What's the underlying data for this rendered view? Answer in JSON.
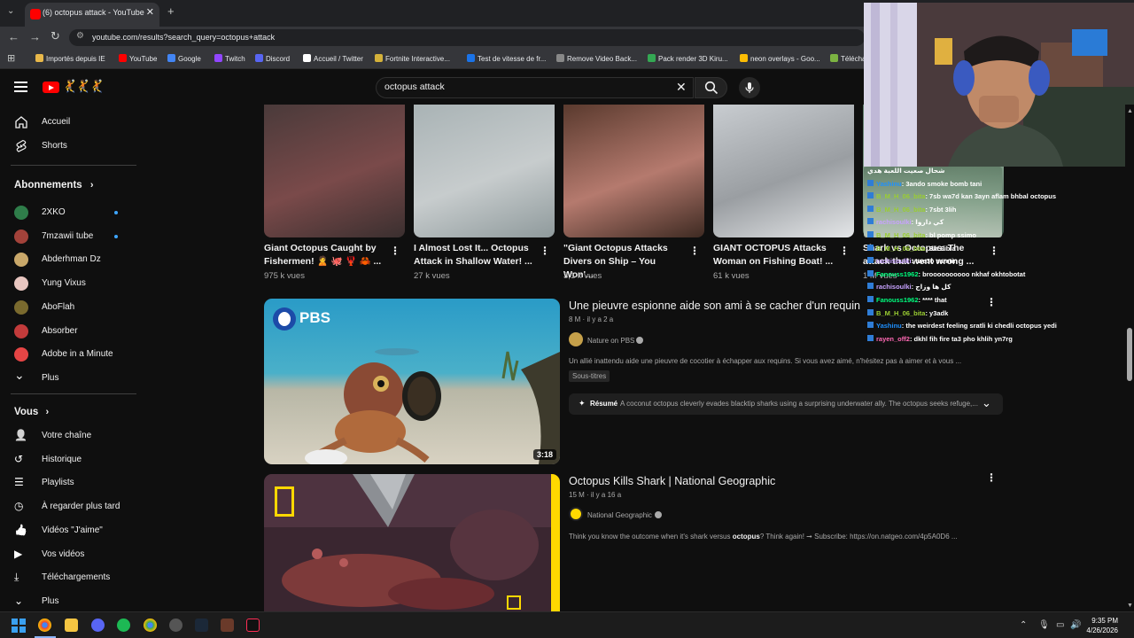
{
  "browser": {
    "tab_title": "(6) octopus attack - YouTube",
    "url": "youtube.com/results?search_query=octopus+attack",
    "bookmarks": [
      {
        "label": "Importés depuis IE",
        "color": "#e8b84a"
      },
      {
        "label": "YouTube",
        "color": "#ff0000"
      },
      {
        "label": "Google",
        "color": "#4285f4"
      },
      {
        "label": "Twitch",
        "color": "#9146ff"
      },
      {
        "label": "Discord",
        "color": "#5865f2"
      },
      {
        "label": "Accueil / Twitter",
        "color": "#ffffff"
      },
      {
        "label": "Fortnite Interactive...",
        "color": "#d4b13a"
      },
      {
        "label": "Test de vitesse de fr...",
        "color": "#1a73e8"
      },
      {
        "label": "Remove Video Back...",
        "color": "#888888"
      },
      {
        "label": "Pack render 3D Kiru...",
        "color": "#34a853"
      },
      {
        "label": "neon overlays - Goo...",
        "color": "#fbbc04"
      },
      {
        "label": "Téléchar...",
        "color": "#7cb342"
      }
    ]
  },
  "header": {
    "search_value": "octopus attack"
  },
  "sidebar": {
    "main": [
      {
        "label": "Accueil",
        "icon": "home-icon"
      },
      {
        "label": "Shorts",
        "icon": "shorts-icon"
      }
    ],
    "subscriptions_title": "Abonnements",
    "subscriptions": [
      {
        "label": "2XKO",
        "color": "#2f7d4a",
        "dot": true
      },
      {
        "label": "7mzawii tube",
        "color": "#a3423a",
        "dot": true
      },
      {
        "label": "Abderhman Dz",
        "color": "#c9a86a",
        "dot": false
      },
      {
        "label": "Yung Vixus",
        "color": "#e8c6c0",
        "dot": false
      },
      {
        "label": "AboFlah",
        "color": "#7a6a2e",
        "dot": false
      },
      {
        "label": "Absorber",
        "color": "#c23b3b",
        "dot": false
      },
      {
        "label": "Adobe in a Minute",
        "color": "#e64545",
        "dot": false
      },
      {
        "label": "Plus",
        "color": "",
        "dot": false
      }
    ],
    "you_title": "Vous",
    "you": [
      {
        "label": "Votre chaîne",
        "icon": "channel-icon"
      },
      {
        "label": "Historique",
        "icon": "history-icon"
      },
      {
        "label": "Playlists",
        "icon": "playlists-icon"
      },
      {
        "label": "À regarder plus tard",
        "icon": "watch-later-icon"
      },
      {
        "label": "Vidéos \"J'aime\"",
        "icon": "like-icon"
      },
      {
        "label": "Vos vidéos",
        "icon": "your-videos-icon"
      },
      {
        "label": "Téléchargements",
        "icon": "downloads-icon"
      },
      {
        "label": "Plus",
        "icon": "chevron-down-icon"
      }
    ]
  },
  "shorts": [
    {
      "title": "Giant Octopus Caught by Fishermen! 🙎 🐙 🦞 🦀 ...",
      "views": "975 k vues",
      "colors": [
        "#4a3a3a",
        "#7a4a4a",
        "#3a2f2f"
      ]
    },
    {
      "title": "I Almost Lost It... Octopus Attack in Shallow Water! ...",
      "views": "27 k vues",
      "colors": [
        "#a9b3b5",
        "#c7cccd",
        "#8f9a9c"
      ]
    },
    {
      "title": "\"Giant Octopus Attacks Divers on Ship – You Won'...",
      "views": "3,1 k vues",
      "colors": [
        "#5a3a2e",
        "#b57a6e",
        "#3e2a22"
      ]
    },
    {
      "title": "GIANT OCTOPUS Attacks Woman on Fishing Boat! ...",
      "views": "61 k vues",
      "colors": [
        "#c8ccd0",
        "#9a9ea2",
        "#e4e6e8"
      ]
    },
    {
      "title": "Shark vs Octopus: The attack that went wrong ...",
      "views": "1 M vues",
      "colors": [
        "#5a7868",
        "#8aa590",
        "#3e5a4c"
      ]
    }
  ],
  "videos": [
    {
      "title": "Une pieuvre espionne aide son ami à se cacher d'un requin",
      "meta": "8 M · il y a 2 a",
      "channel": "Nature on PBS",
      "desc": "Un allié inattendu aide une pieuvre de cocotier à échapper aux requins. Si vous avez aimé, n'hésitez pas à aimer et à vous ...",
      "badge": "Sous-titres",
      "summary_label": "Résumé",
      "summary": "A coconut octopus cleverly evades blacktip sharks using a surprising underwater ally. The octopus seeks refuge,...",
      "duration": "3:18",
      "brand": "PBS"
    },
    {
      "title": "Octopus Kills Shark | National Geographic",
      "meta": "15 M · il y a 16 a",
      "channel": "National Geographic",
      "desc_pre": "Think you know the outcome when it's shark versus ",
      "desc_bold": "octopus",
      "desc_post": "? Think again! ➞ Subscribe: https://on.natgeo.com/4p5A0D6 ..."
    }
  ],
  "chat": [
    {
      "user": "",
      "msg": "شحال صعيت اللعبة هدي",
      "color": "#ffffff"
    },
    {
      "user": "Yashinu",
      "msg": ": 3ando smoke bomb tani",
      "color": "#1e90ff"
    },
    {
      "user": "B_M_H_06_bita",
      "msg": ": 7sb wa7d kan 3ayn aflam bhbal octopus",
      "color": "#9acd32"
    },
    {
      "user": "B_M_H_06_bita",
      "msg": ": 7sbt 3lih",
      "color": "#9acd32"
    },
    {
      "user": "rachisoulki",
      "msg": ": كي داروا",
      "color": "#c8a2ff"
    },
    {
      "user": "B_M_H_06_bita",
      "msg": ": bl pomp ssimo",
      "color": "#9acd32"
    },
    {
      "user": "B_M_H_06_bita",
      "msg": ": 3la 9ibla",
      "color": "#9acd32"
    },
    {
      "user": "rachisoulki",
      "msg": ": twe3o samtin",
      "color": "#c8a2ff"
    },
    {
      "user": "Fanouss1962",
      "msg": ": broooooooooo nkhaf okhtobotat",
      "color": "#00ff7f"
    },
    {
      "user": "rachisoulki",
      "msg": ": كل ها وزاج",
      "color": "#c8a2ff"
    },
    {
      "user": "Fanouss1962",
      "msg": ": **** that",
      "color": "#00ff7f"
    },
    {
      "user": "B_M_H_06_bita",
      "msg": ": y3adk",
      "color": "#9acd32"
    },
    {
      "user": "Yashinu",
      "msg": ": the weirdest feeling sratli ki chedli octopus yedi",
      "color": "#1e90ff"
    },
    {
      "user": "rayen_off2",
      "msg": ": dkhl fih fire ta3 pho khlih yn7rg",
      "color": "#ff69b4"
    }
  ],
  "taskbar": {
    "time": "9:35 PM",
    "date": "4/26/2026"
  },
  "colors": {
    "accent": "#ff0000",
    "link": "#3ea6ff",
    "bg": "#0f0f0f"
  }
}
